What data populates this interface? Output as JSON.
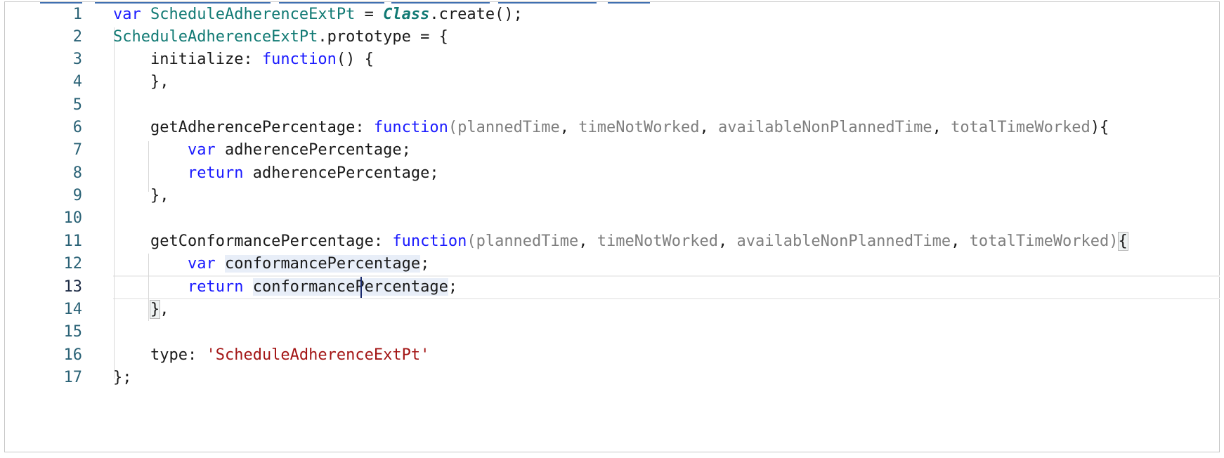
{
  "editor": {
    "line_numbers": [
      "1",
      "2",
      "3",
      "4",
      "5",
      "6",
      "7",
      "8",
      "9",
      "10",
      "11",
      "12",
      "13",
      "14",
      "15",
      "16",
      "17"
    ],
    "active_line": "13",
    "code": {
      "l1": {
        "kw": "var",
        "name": "ScheduleAdherenceExtPt",
        "op": " = ",
        "cls": "Class",
        "rest": ".create();"
      },
      "l2": {
        "name": "ScheduleAdherenceExtPt",
        "rest": ".prototype = {"
      },
      "l3": {
        "key": "initialize: ",
        "kw": "function",
        "rest": "() {"
      },
      "l4": {
        "text": "},"
      },
      "l6": {
        "key": "getAdherencePercentage: ",
        "kw": "function",
        "open": "(",
        "p1": "plannedTime",
        "c1": ", ",
        "p2": "timeNotWorked",
        "c2": ", ",
        "p3": "availableNonPlannedTime",
        "c3": ", ",
        "p4": "totalTimeWorked",
        "close": "){"
      },
      "l7": {
        "kw": "var",
        "rest": " adherencePercentage;"
      },
      "l8": {
        "kw": "return",
        "rest": " adherencePercentage;"
      },
      "l9": {
        "text": "},"
      },
      "l11": {
        "key": "getConformancePercentage: ",
        "kw": "function",
        "open": "(",
        "p1": "plannedTime",
        "c1": ", ",
        "p2": "timeNotWorked",
        "c2": ", ",
        "p3": "availableNonPlannedTime",
        "c3": ", ",
        "p4": "totalTimeWorked",
        "close": ")",
        "brace": "{"
      },
      "l12": {
        "kw": "var",
        "sp": " ",
        "word": "conformancePercentage",
        "end": ";"
      },
      "l13": {
        "kw": "return",
        "sp": " ",
        "word": "conformancePercentage",
        "end": ";"
      },
      "l14": {
        "brace": "}",
        "rest": ","
      },
      "l16": {
        "key": "type: ",
        "str": "'ScheduleAdherenceExtPt'"
      },
      "l17": {
        "text": "};"
      }
    }
  }
}
